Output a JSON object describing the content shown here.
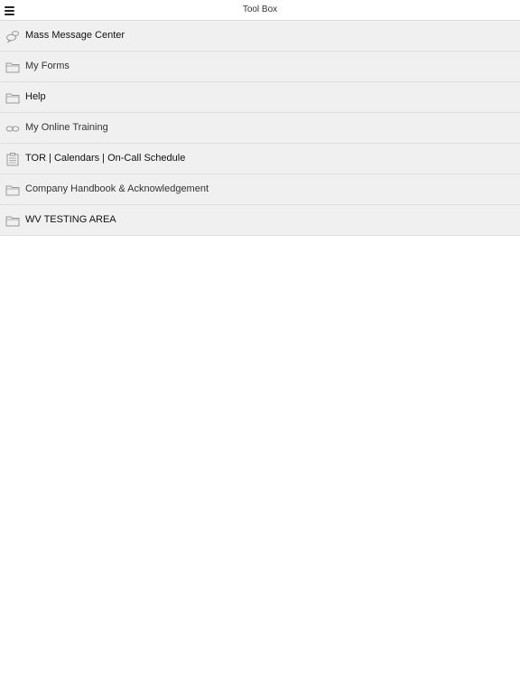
{
  "header": {
    "title": "Tool Box",
    "menu_icon": "hamburger-menu-icon"
  },
  "items": [
    {
      "label": "Mass Message Center",
      "icon": "chat-bubbles-icon"
    },
    {
      "label": "My Forms",
      "icon": "folder-icon"
    },
    {
      "label": "Help",
      "icon": "folder-icon"
    },
    {
      "label": "My Online Training",
      "icon": "infinity-link-icon"
    },
    {
      "label": "TOR | Calendars | On-Call Schedule",
      "icon": "clipboard-icon"
    },
    {
      "label": "Company Handbook & Acknowledgement",
      "icon": "folder-icon"
    },
    {
      "label": "WV TESTING AREA",
      "icon": "folder-icon"
    }
  ],
  "colors": {
    "list_background": "#f0f0f0",
    "divider": "#dddddd",
    "icon_gray": "#9a9a9a"
  }
}
